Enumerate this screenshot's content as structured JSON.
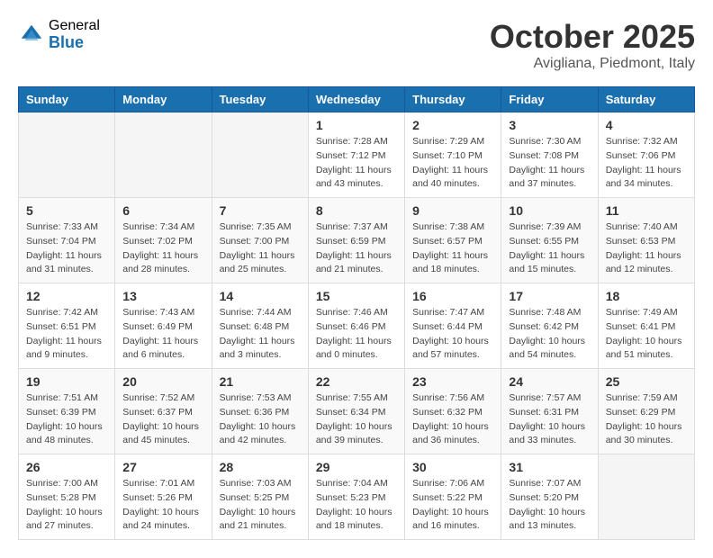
{
  "logo": {
    "general": "General",
    "blue": "Blue"
  },
  "title": "October 2025",
  "location": "Avigliana, Piedmont, Italy",
  "weekdays": [
    "Sunday",
    "Monday",
    "Tuesday",
    "Wednesday",
    "Thursday",
    "Friday",
    "Saturday"
  ],
  "weeks": [
    [
      {
        "day": "",
        "info": ""
      },
      {
        "day": "",
        "info": ""
      },
      {
        "day": "",
        "info": ""
      },
      {
        "day": "1",
        "info": "Sunrise: 7:28 AM\nSunset: 7:12 PM\nDaylight: 11 hours and 43 minutes."
      },
      {
        "day": "2",
        "info": "Sunrise: 7:29 AM\nSunset: 7:10 PM\nDaylight: 11 hours and 40 minutes."
      },
      {
        "day": "3",
        "info": "Sunrise: 7:30 AM\nSunset: 7:08 PM\nDaylight: 11 hours and 37 minutes."
      },
      {
        "day": "4",
        "info": "Sunrise: 7:32 AM\nSunset: 7:06 PM\nDaylight: 11 hours and 34 minutes."
      }
    ],
    [
      {
        "day": "5",
        "info": "Sunrise: 7:33 AM\nSunset: 7:04 PM\nDaylight: 11 hours and 31 minutes."
      },
      {
        "day": "6",
        "info": "Sunrise: 7:34 AM\nSunset: 7:02 PM\nDaylight: 11 hours and 28 minutes."
      },
      {
        "day": "7",
        "info": "Sunrise: 7:35 AM\nSunset: 7:00 PM\nDaylight: 11 hours and 25 minutes."
      },
      {
        "day": "8",
        "info": "Sunrise: 7:37 AM\nSunset: 6:59 PM\nDaylight: 11 hours and 21 minutes."
      },
      {
        "day": "9",
        "info": "Sunrise: 7:38 AM\nSunset: 6:57 PM\nDaylight: 11 hours and 18 minutes."
      },
      {
        "day": "10",
        "info": "Sunrise: 7:39 AM\nSunset: 6:55 PM\nDaylight: 11 hours and 15 minutes."
      },
      {
        "day": "11",
        "info": "Sunrise: 7:40 AM\nSunset: 6:53 PM\nDaylight: 11 hours and 12 minutes."
      }
    ],
    [
      {
        "day": "12",
        "info": "Sunrise: 7:42 AM\nSunset: 6:51 PM\nDaylight: 11 hours and 9 minutes."
      },
      {
        "day": "13",
        "info": "Sunrise: 7:43 AM\nSunset: 6:49 PM\nDaylight: 11 hours and 6 minutes."
      },
      {
        "day": "14",
        "info": "Sunrise: 7:44 AM\nSunset: 6:48 PM\nDaylight: 11 hours and 3 minutes."
      },
      {
        "day": "15",
        "info": "Sunrise: 7:46 AM\nSunset: 6:46 PM\nDaylight: 11 hours and 0 minutes."
      },
      {
        "day": "16",
        "info": "Sunrise: 7:47 AM\nSunset: 6:44 PM\nDaylight: 10 hours and 57 minutes."
      },
      {
        "day": "17",
        "info": "Sunrise: 7:48 AM\nSunset: 6:42 PM\nDaylight: 10 hours and 54 minutes."
      },
      {
        "day": "18",
        "info": "Sunrise: 7:49 AM\nSunset: 6:41 PM\nDaylight: 10 hours and 51 minutes."
      }
    ],
    [
      {
        "day": "19",
        "info": "Sunrise: 7:51 AM\nSunset: 6:39 PM\nDaylight: 10 hours and 48 minutes."
      },
      {
        "day": "20",
        "info": "Sunrise: 7:52 AM\nSunset: 6:37 PM\nDaylight: 10 hours and 45 minutes."
      },
      {
        "day": "21",
        "info": "Sunrise: 7:53 AM\nSunset: 6:36 PM\nDaylight: 10 hours and 42 minutes."
      },
      {
        "day": "22",
        "info": "Sunrise: 7:55 AM\nSunset: 6:34 PM\nDaylight: 10 hours and 39 minutes."
      },
      {
        "day": "23",
        "info": "Sunrise: 7:56 AM\nSunset: 6:32 PM\nDaylight: 10 hours and 36 minutes."
      },
      {
        "day": "24",
        "info": "Sunrise: 7:57 AM\nSunset: 6:31 PM\nDaylight: 10 hours and 33 minutes."
      },
      {
        "day": "25",
        "info": "Sunrise: 7:59 AM\nSunset: 6:29 PM\nDaylight: 10 hours and 30 minutes."
      }
    ],
    [
      {
        "day": "26",
        "info": "Sunrise: 7:00 AM\nSunset: 5:28 PM\nDaylight: 10 hours and 27 minutes."
      },
      {
        "day": "27",
        "info": "Sunrise: 7:01 AM\nSunset: 5:26 PM\nDaylight: 10 hours and 24 minutes."
      },
      {
        "day": "28",
        "info": "Sunrise: 7:03 AM\nSunset: 5:25 PM\nDaylight: 10 hours and 21 minutes."
      },
      {
        "day": "29",
        "info": "Sunrise: 7:04 AM\nSunset: 5:23 PM\nDaylight: 10 hours and 18 minutes."
      },
      {
        "day": "30",
        "info": "Sunrise: 7:06 AM\nSunset: 5:22 PM\nDaylight: 10 hours and 16 minutes."
      },
      {
        "day": "31",
        "info": "Sunrise: 7:07 AM\nSunset: 5:20 PM\nDaylight: 10 hours and 13 minutes."
      },
      {
        "day": "",
        "info": ""
      }
    ]
  ]
}
